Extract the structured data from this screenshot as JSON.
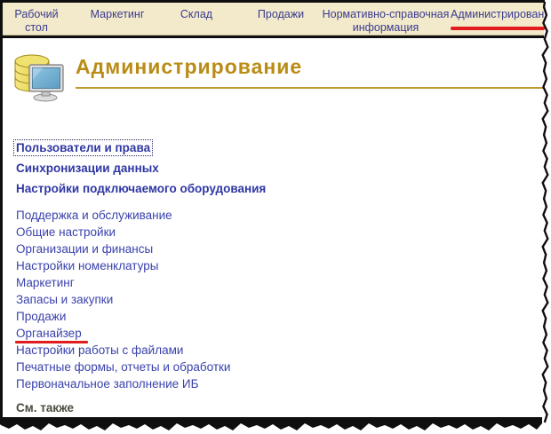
{
  "tabs": [
    {
      "label": "Рабочий\nстол"
    },
    {
      "label": "Маркетинг"
    },
    {
      "label": "Склад"
    },
    {
      "label": "Продажи"
    },
    {
      "label": "Нормативно-справочная\nинформация"
    },
    {
      "label": "Администрирование"
    }
  ],
  "header": {
    "title": "Администрирование",
    "icon": "database-computer-icon"
  },
  "sections": {
    "primary_links": [
      "Пользователи и права",
      "Синхронизации данных",
      "Настройки подключаемого оборудования"
    ],
    "secondary_links": [
      "Поддержка и обслуживание",
      "Общие настройки",
      "Организации и финансы",
      "Настройки номенклатуры",
      "Маркетинг",
      "Запасы и закупки",
      "Продажи",
      "Органайзер",
      "Настройки работы с файлами",
      "Печатные формы, отчеты и обработки",
      "Первоначальное заполнение ИБ"
    ],
    "see_also_label": "См. также"
  },
  "state": {
    "focused_link": "Пользователи и права"
  },
  "annotations": {
    "highlighted_tab": "Администрирование",
    "highlighted_link": "Органайзер",
    "color": "#e01c1c"
  },
  "colors": {
    "tabbar_bg": "#f2eacb",
    "tab_text": "#3b3b90",
    "title_gold": "#ba8c16",
    "link_blue": "#3a42ac",
    "link_bold_blue": "#2f37a3",
    "see_also_text": "#4a4a3e",
    "frame_black": "#0f0f0f"
  }
}
